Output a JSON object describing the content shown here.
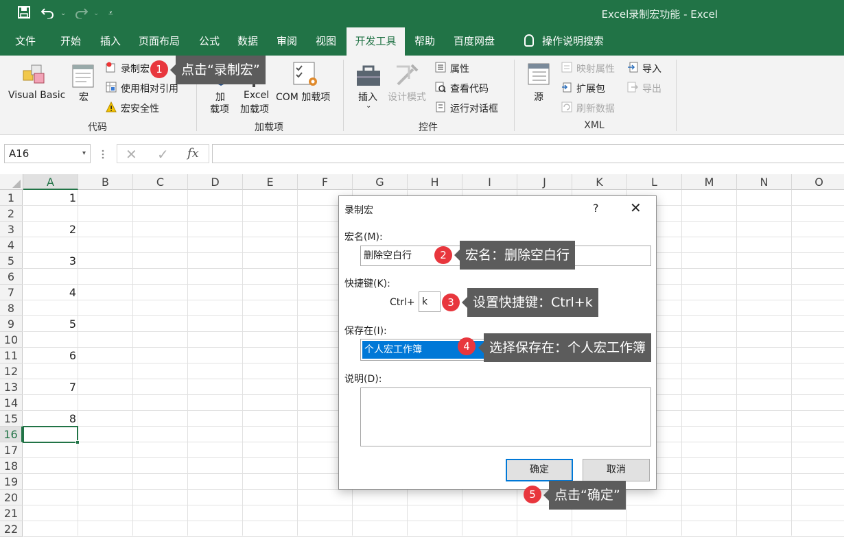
{
  "window": {
    "title": "Excel录制宏功能  -  Excel"
  },
  "tabs": [
    "文件",
    "开始",
    "插入",
    "页面布局",
    "公式",
    "数据",
    "审阅",
    "视图",
    "开发工具",
    "帮助",
    "百度网盘"
  ],
  "tell_me": "操作说明搜索",
  "ribbon": {
    "code": {
      "visual_basic": "Visual Basic",
      "macros": "宏",
      "record_macro": "录制宏",
      "relative_refs": "使用相对引用",
      "macro_security": "宏安全性",
      "group": "代码"
    },
    "addins": {
      "addins_line1": "加",
      "addins_line2": "载项",
      "excel_addins_line1": "Excel",
      "excel_addins_line2": "加载项",
      "com_addins": "COM 加载项",
      "group": "加载项"
    },
    "controls": {
      "insert": "插入",
      "design_mode": "设计模式",
      "properties": "属性",
      "view_code": "查看代码",
      "run_dialog": "运行对话框",
      "group": "控件"
    },
    "xml": {
      "source": "源",
      "map_properties": "映射属性",
      "expansion_packs": "扩展包",
      "refresh_data": "刷新数据",
      "import": "导入",
      "export": "导出",
      "group": "XML"
    }
  },
  "formula_bar": {
    "name_box": "A16",
    "fx": "fx"
  },
  "columns": [
    "A",
    "B",
    "C",
    "D",
    "E",
    "F",
    "G",
    "H",
    "I",
    "J",
    "K",
    "L",
    "M",
    "N",
    "O"
  ],
  "rows": [
    "1",
    "2",
    "3",
    "4",
    "5",
    "6",
    "7",
    "8",
    "9",
    "10",
    "11",
    "12",
    "13",
    "14",
    "15",
    "16",
    "17",
    "18",
    "19",
    "20",
    "21",
    "22"
  ],
  "cells_a": [
    "1",
    "",
    "2",
    "",
    "3",
    "",
    "4",
    "",
    "5",
    "",
    "6",
    "",
    "7",
    "",
    "8"
  ],
  "dialog": {
    "title": "录制宏",
    "help": "?",
    "macro_name_label": "宏名(M):",
    "macro_name_value": "删除空白行",
    "shortcut_label": "快捷键(K):",
    "ctrl_prefix": "Ctrl+",
    "shortcut_value": "k",
    "store_in_label": "保存在(I):",
    "store_in_value": "个人宏工作簿",
    "description_label": "说明(D):",
    "ok": "确定",
    "cancel": "取消"
  },
  "callouts": [
    {
      "num": "1",
      "text": "点击“录制宏”"
    },
    {
      "num": "2",
      "text": "宏名：删除空白行"
    },
    {
      "num": "3",
      "text": "设置快捷键：Ctrl+k"
    },
    {
      "num": "4",
      "text": "选择保存在：个人宏工作簿"
    },
    {
      "num": "5",
      "text": "点击“确定”"
    }
  ]
}
